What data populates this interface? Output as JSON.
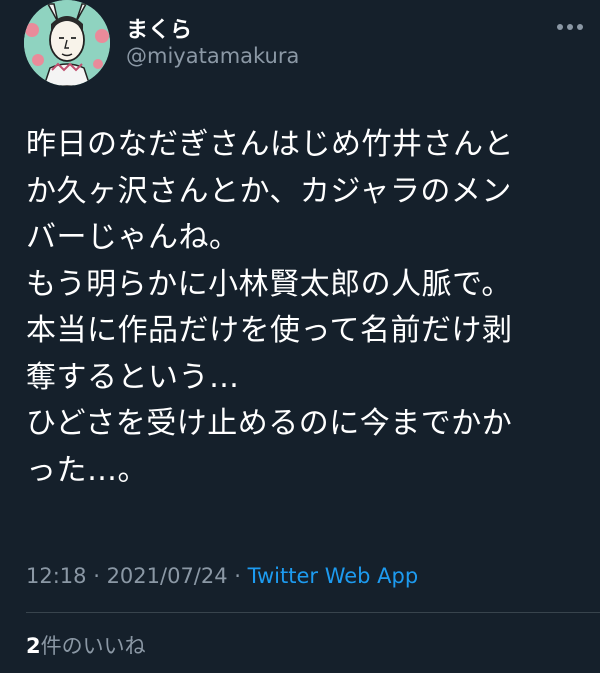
{
  "user": {
    "display_name": "まくら",
    "handle": "@miyatamakura",
    "avatar_icon": "avatar-illustration"
  },
  "tweet": {
    "lines": [
      "昨日のなだぎさんはじめ竹井さんと",
      "か久ヶ沢さんとか、カジャラのメン",
      "バーじゃんね。",
      "もう明らかに小林賢太郎の人脈で。",
      "本当に作品だけを使って名前だけ剥",
      "奪するという…",
      "ひどさを受け止めるのに今までかか",
      "った…。"
    ]
  },
  "meta": {
    "time": "12:18",
    "separator1": " · ",
    "date": "2021/07/24",
    "separator2": " · ",
    "source": "Twitter Web App"
  },
  "likes": {
    "count": "2",
    "label": "件のいいね"
  },
  "colors": {
    "background": "#15202b",
    "text": "#ffffff",
    "secondary": "#8b98a5",
    "accent": "#1d9bf0",
    "divider": "#38444d"
  },
  "icons": {
    "more": "more-horizontal-icon"
  }
}
